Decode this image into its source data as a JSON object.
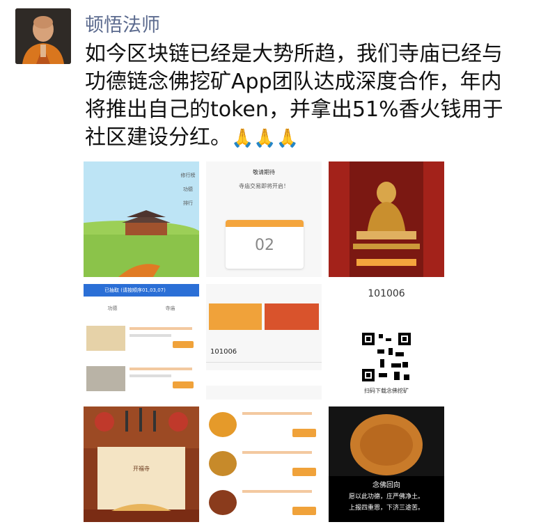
{
  "post": {
    "author_name": "顿悟法师",
    "text_lines": [
      "如今区块链已经是大势所趋，我们寺庙已经与",
      "功德链念佛挖矿App团队达成深度合作，年内",
      "将推出自己的token，并拿出51%香火钱用于",
      "社区建设分红。"
    ],
    "emoji": "🙏🙏🙏"
  },
  "images": {
    "img1": {
      "side_items": [
        "修行榜",
        "功德",
        "排行"
      ]
    },
    "img2": {
      "title": "敬请期待",
      "subtitle": "寺庙交易即将开启！",
      "countdown": "02"
    },
    "img5": {
      "number": "101006"
    },
    "img4": {
      "banner": "已抽取 (请按顺序01,03,07)",
      "tab_left": "功德",
      "tab_right": "寺庙"
    },
    "img6": {
      "caption": "扫码下载念佛挖矿"
    },
    "img7": {
      "title": "开福寺"
    },
    "img9": {
      "title": "念佛回向",
      "lines": [
        "愿以此功德，庄严佛净土。",
        "上报四重恩，下济三途苦。"
      ]
    }
  },
  "colors": {
    "orange": "#f0a23a",
    "red": "#c0392b",
    "name_blue": "#5b6a8e"
  }
}
